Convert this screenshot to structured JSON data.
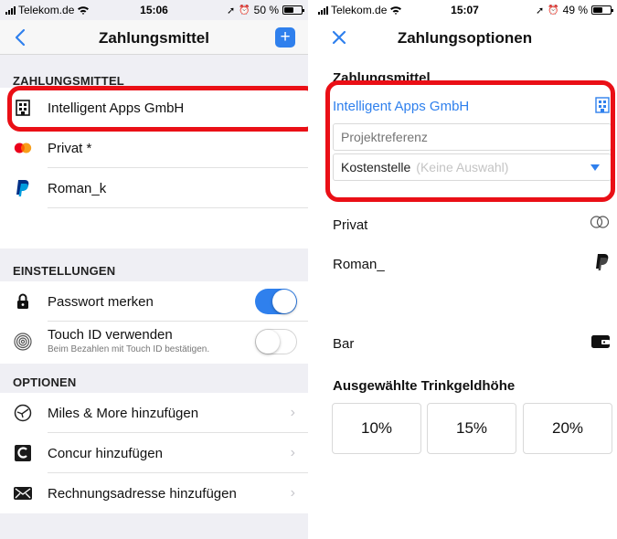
{
  "left": {
    "status": {
      "carrier": "Telekom.de",
      "time": "15:06",
      "battery": "50 %",
      "battery_level": 0.5
    },
    "nav": {
      "title": "Zahlungsmittel"
    },
    "payment_section": {
      "header": "ZAHLUNGSMITTEL",
      "items": [
        {
          "label": "Intelligent Apps GmbH",
          "icon": "building-icon"
        },
        {
          "label": "Privat *",
          "icon": "mastercard-icon"
        },
        {
          "label": "Roman_k",
          "icon": "paypal-icon"
        }
      ]
    },
    "settings_section": {
      "header": "EINSTELLUNGEN",
      "items": [
        {
          "label": "Passwort merken",
          "icon": "lock-icon",
          "toggle": true
        },
        {
          "label": "Touch ID verwenden",
          "sublabel": "Beim Bezahlen mit Touch ID bestätigen.",
          "icon": "fingerprint-icon",
          "toggle": false
        }
      ]
    },
    "options_section": {
      "header": "OPTIONEN",
      "items": [
        {
          "label": "Miles & More hinzufügen",
          "icon": "lufthansa-icon"
        },
        {
          "label": "Concur hinzufügen",
          "icon": "concur-icon"
        },
        {
          "label": "Rechnungsadresse hinzufügen",
          "icon": "envelope-icon"
        }
      ]
    }
  },
  "right": {
    "status": {
      "carrier": "Telekom.de",
      "time": "15:07",
      "battery": "49 %",
      "battery_level": 0.49
    },
    "nav": {
      "title": "Zahlungsoptionen"
    },
    "payment_heading": "Zahlungsmittel",
    "company": {
      "label": "Intelligent Apps GmbH",
      "color": "#2f80ed"
    },
    "project_ref": {
      "placeholder": "Projektreferenz"
    },
    "cost_center": {
      "label": "Kostenstelle",
      "hint": "(Keine Auswahl)"
    },
    "methods": [
      {
        "label": "Privat",
        "icon": "mastercard-icon"
      },
      {
        "label": "Roman_",
        "icon": "paypal-icon"
      },
      {
        "label": "Bar",
        "icon": "wallet-icon"
      }
    ],
    "tip_heading": "Ausgewählte Trinkgeldhöhe",
    "tips": [
      "10%",
      "15%",
      "20%"
    ]
  },
  "colors": {
    "accent": "#2f80ed",
    "highlight": "#ea0f16"
  }
}
